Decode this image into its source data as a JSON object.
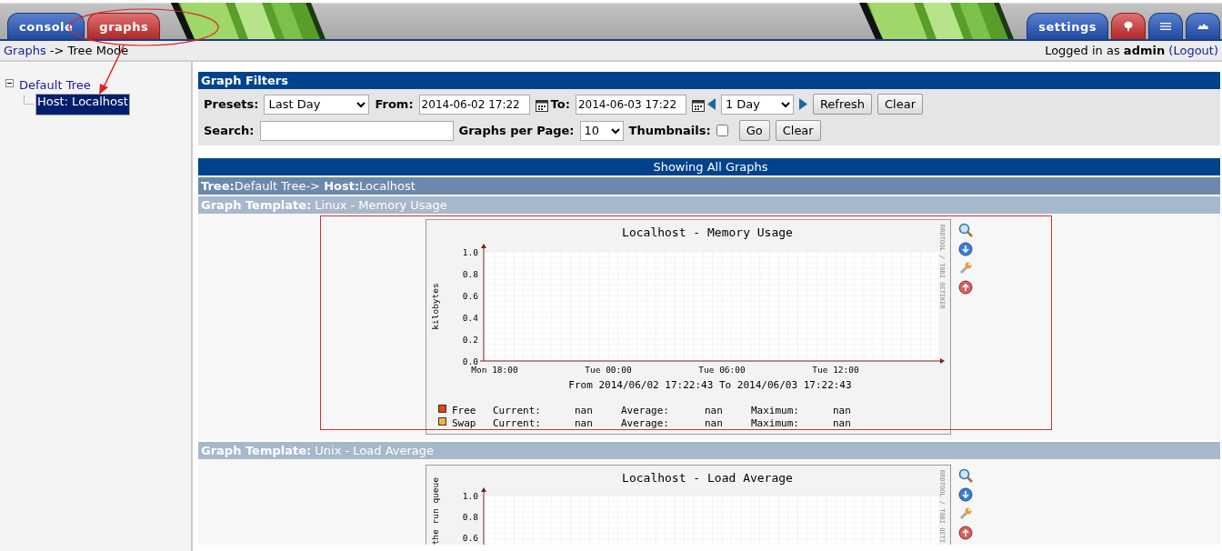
{
  "tabs": [
    {
      "label": "console",
      "selected": false
    },
    {
      "label": "graphs",
      "selected": true
    }
  ],
  "right_tabs": [
    {
      "kind": "text",
      "label": "settings",
      "selected": false
    },
    {
      "kind": "tree",
      "selected": true
    },
    {
      "kind": "list",
      "selected": false
    },
    {
      "kind": "preview",
      "selected": false
    }
  ],
  "breadcrumb": {
    "link": "Graphs",
    "text": "-> Tree Mode"
  },
  "login": {
    "text": "Logged in as **admin**",
    "logout": "(Logout)"
  },
  "tree": [
    {
      "label": "Default Tree",
      "expanded": true,
      "children": [
        {
          "label": "Host: Localhost",
          "selected": true
        }
      ]
    }
  ],
  "filters": {
    "title": "Graph Filters",
    "presets_label": "Presets:",
    "presets_value": "Last Day",
    "from_label": "From:",
    "from_value": "2014-06-02 17:22",
    "to_label": "To:",
    "to_value": "2014-06-03 17:22",
    "timespan_value": "1 Day",
    "refresh": "Refresh",
    "clear": "Clear",
    "search_label": "Search:",
    "graphs_per_page_label": "Graphs per Page:",
    "graphs_per_page_value": "10",
    "thumbnails_label": "Thumbnails:",
    "thumbnails_checked": false,
    "go": "Go",
    "clear_search": "Clear"
  },
  "showing": "Showing All Graphs",
  "tree_path": "**Tree:**Default Tree-> **Host:**Localhost",
  "graphs": [
    {
      "template": "**Graph Template:** Linux - Memory Usage",
      "title": "Localhost - Memory Usage",
      "ylabel": "kilobytes",
      "yticks": [
        "1.0",
        "0.8",
        "0.6",
        "0.4",
        "0.2",
        "0.0"
      ],
      "xticks": [
        "Mon 18:00",
        "Tue 00:00",
        "Tue 06:00",
        "Tue 12:00"
      ],
      "range": "From 2014/06/02 17:22:43 To 2014/06/03 17:22:43",
      "credit": "RRDTOOL / TOBI OETIKER",
      "legend": [
        {
          "name": "Free",
          "color": "#e8401a",
          "current_label": "Current:",
          "current": "nan",
          "average_label": "Average:",
          "average": "nan",
          "maximum_label": "Maximum:",
          "maximum": "nan"
        },
        {
          "name": "Swap",
          "color": "#f5b041",
          "current_label": "Current:",
          "current": "nan",
          "average_label": "Average:",
          "average": "nan",
          "maximum_label": "Maximum:",
          "maximum": "nan"
        }
      ]
    },
    {
      "template": "**Graph Template:** Unix - Load Average",
      "title": "Localhost - Load Average",
      "ylabel": "the run queue",
      "yticks": [
        "1.0",
        "0.8",
        "0.6"
      ],
      "credit": "RRDTOOL / TOBI OETI"
    }
  ]
}
